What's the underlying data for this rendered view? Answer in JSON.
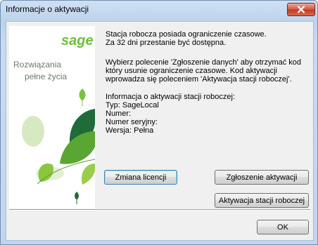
{
  "window": {
    "title": "Informacje o aktywacji",
    "close_icon": "close-icon"
  },
  "banner": {
    "logo": "sage",
    "slogan_line1": "Rozwiązania",
    "slogan_line2": "pełne życia",
    "colors": {
      "brand_green": "#6bbf3a",
      "dark_green": "#1f6b3a"
    }
  },
  "message": {
    "line1": "Stacja robocza posiada ograniczenie czasowe.",
    "line2": "Za 32 dni przestanie być dostępna.",
    "para2_line1": "Wybierz polecenie 'Zgłoszenie danych' aby otrzymać kod",
    "para2_line2": "który usunie ograniczenie czasowe. Kod aktywacji",
    "para2_line3": "wprowadza się poleceniem 'Aktywacja stacji roboczej'.",
    "info_header": "Informacja o aktywacji stacji roboczej:",
    "type": "Typ: SageLocal",
    "number": "Numer:",
    "serial": "Numer seryjny:",
    "version": "Wersja: Pełna"
  },
  "buttons": {
    "change_license": "Zmiana licencji",
    "report_activation": "Zgłoszenie aktywacji",
    "activate_station": "Aktywacja stacji roboczej",
    "ok": "OK"
  }
}
